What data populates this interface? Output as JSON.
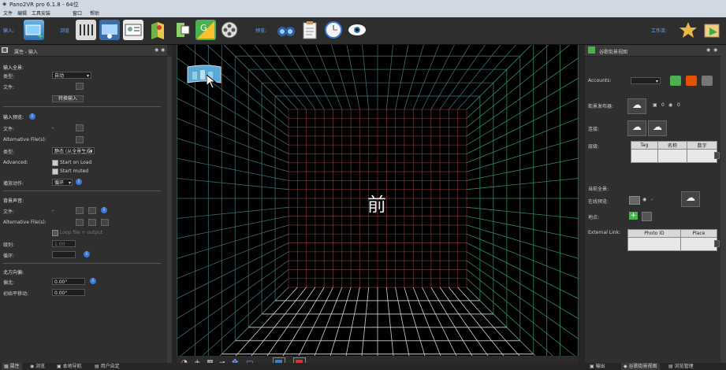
{
  "window": {
    "title": "Pano2VR pro 6.1.8 - 64位"
  },
  "menu": [
    "文件",
    "编辑",
    "工具安装",
    "窗口",
    "帮助"
  ],
  "toolbar": {
    "input_label": "输入:",
    "tour_label": "浏览",
    "output_label": "预览:",
    "workflow_label": "工作流:",
    "icons": [
      "add-input-icon",
      "panorama-editor-icon",
      "viewpoint-icon",
      "properties-icon",
      "map-icon",
      "patch-icon",
      "google-street-view-icon",
      "film-reel-icon",
      "binoculars-icon",
      "clipboard-icon",
      "clock-icon",
      "eye-preview-icon",
      "workflow-star-icon",
      "workflow-export-icon"
    ]
  },
  "left_panel": {
    "title": "属性 - 输入",
    "section_input": "输入全景:",
    "type_label": "类型:",
    "type_value": "自动",
    "file_label": "文件:",
    "convert_button": "转换输入",
    "section_preview": "输入预览:",
    "preview_file_label": "文件:",
    "alt_files_label": "Alternative File(s):",
    "mode_label": "类型:",
    "mode_value": "静态 (从全景生成)",
    "advanced_label": "Advanced:",
    "start_on_load": "Start on Load",
    "start_muted": "Start muted",
    "loop_label": "播放动作:",
    "loop_value": "循环",
    "section_audio": "背景声音:",
    "audio_file_label": "文件:",
    "audio_alt_label": "Alternative File(s):",
    "audio_loop_text": "Loop file + output",
    "level_label": "级别:",
    "level_value": "1.00",
    "loop2_label": "循环:",
    "section_offset": "北方向偏:",
    "north_label": "偏北:",
    "north_value": "0.00°",
    "pan_label": "初始平移动:",
    "pan_value": "0.00°"
  },
  "viewport": {
    "face_label": "前",
    "colors": {
      "outer": "#2e8b57",
      "mid": "#3a6b6b",
      "inner": "#7a3232",
      "floor": "#d0d0d0"
    }
  },
  "right_panel": {
    "title": "谷歌街景视图",
    "accounts_label": "Accounts:",
    "upload_label": "街景发布器:",
    "counter1": "0",
    "counter2": "0",
    "connect_label": "连接:",
    "level_label": "层级:",
    "table1_headers": [
      "Tag",
      "名称",
      "数字"
    ],
    "current_label": "当前全景:",
    "preview_label": "在线预览:",
    "place_label": "地点:",
    "external_label": "External Link:",
    "table2_headers": [
      "Photo ID",
      "Place"
    ]
  },
  "status_tabs_left": [
    "属性",
    "浏览",
    "本地导航",
    "用户自定"
  ],
  "status_tabs_right": [
    "输出",
    "谷歌街景视图",
    "浏览管理"
  ],
  "viewport_toolbar_icons": [
    "compass-icon",
    "plus-icon",
    "grid-icon",
    "line-icon",
    "move-icon",
    "screen-icon",
    "view-mode-icon",
    "record-icon"
  ]
}
